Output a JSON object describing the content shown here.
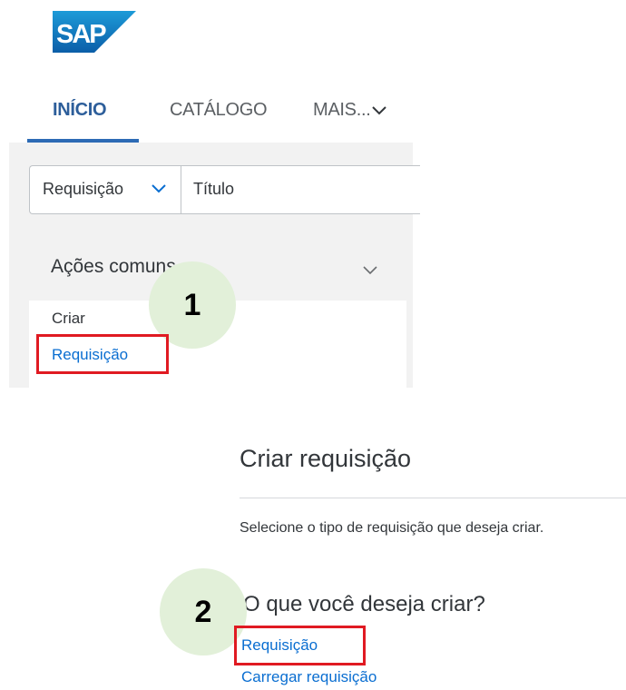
{
  "brand": {
    "logo_text": "SAP",
    "color_top": "#1d9bd8",
    "color_bottom": "#0b5ea8"
  },
  "nav": {
    "tabs": [
      {
        "label": "INÍCIO",
        "active": true
      },
      {
        "label": "CATÁLOGO",
        "active": false
      },
      {
        "label": "MAIS...",
        "active": false
      }
    ]
  },
  "search": {
    "type_label": "Requisição",
    "field_placeholder": "Título"
  },
  "common_actions": {
    "title": "Ações comuns",
    "create_label": "Criar",
    "requisition_link": "Requisição"
  },
  "steps": [
    "1",
    "2"
  ],
  "dialog": {
    "title": "Criar requisição",
    "description": "Selecione o tipo de requisição que deseja criar.",
    "question": "O que você deseja criar?",
    "options": [
      "Requisição",
      "Carregar requisição"
    ]
  },
  "colors": {
    "accent_link": "#0a6ed1",
    "active_tab": "#2d5e9a",
    "highlight_box": "#e01a22",
    "step_bubble": "#e2f0d9"
  }
}
